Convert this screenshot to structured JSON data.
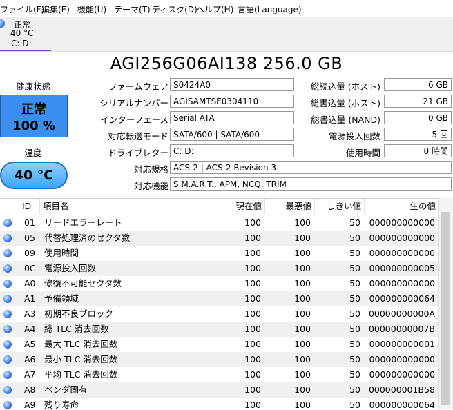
{
  "menu": [
    "ファイル(F)",
    "編集(E)",
    "機能(U)",
    "テーマ(T)",
    "ディスク(D)",
    "ヘルプ(H)",
    "言語(Language)"
  ],
  "drive_tab": {
    "status": "正常",
    "temp": "40 °C",
    "letters": "C: D:"
  },
  "model": "AGI256G06AI138 256.0 GB",
  "health": {
    "label": "健康状態",
    "status": "正常",
    "percent": "100 %"
  },
  "temperature": {
    "label": "温度",
    "value": "40 °C"
  },
  "info_left": [
    {
      "label": "ファームウェア",
      "value": "S0424A0"
    },
    {
      "label": "シリアルナンバー",
      "value": "AGISAMTSE0304110"
    },
    {
      "label": "インターフェース",
      "value": "Serial ATA"
    },
    {
      "label": "対応転送モード",
      "value": "SATA/600 | SATA/600"
    },
    {
      "label": "ドライブレター",
      "value": "C: D:"
    }
  ],
  "info_right": [
    {
      "label": "総読込量 (ホスト)",
      "value": "6 GB"
    },
    {
      "label": "総書込量 (ホスト)",
      "value": "21 GB"
    },
    {
      "label": "総書込量 (NAND)",
      "value": "0 GB"
    },
    {
      "label": "電源投入回数",
      "value": "5 回"
    },
    {
      "label": "使用時間",
      "value": "0 時間"
    }
  ],
  "standard": {
    "label": "対応規格",
    "value": "ACS-2 | ACS-2 Revision 3"
  },
  "features": {
    "label": "対応機能",
    "value": "S.M.A.R.T., APM, NCQ, TRIM"
  },
  "table": {
    "headers": [
      "ID",
      "項目名",
      "現在値",
      "最悪値",
      "しきい値",
      "生の値"
    ],
    "rows": [
      [
        "01",
        "リードエラーレート",
        "100",
        "100",
        "50",
        "000000000000"
      ],
      [
        "05",
        "代替処理済のセクタ数",
        "100",
        "100",
        "50",
        "000000000000"
      ],
      [
        "09",
        "使用時間",
        "100",
        "100",
        "50",
        "000000000000"
      ],
      [
        "0C",
        "電源投入回数",
        "100",
        "100",
        "50",
        "000000000005"
      ],
      [
        "A0",
        "修復不可能セクタ数",
        "100",
        "100",
        "50",
        "000000000000"
      ],
      [
        "A1",
        "予備領域",
        "100",
        "100",
        "50",
        "000000000064"
      ],
      [
        "A3",
        "初期不良ブロック",
        "100",
        "100",
        "50",
        "00000000000A"
      ],
      [
        "A4",
        "総 TLC 消去回数",
        "100",
        "100",
        "50",
        "00000000007B"
      ],
      [
        "A5",
        "最大 TLC 消去回数",
        "100",
        "100",
        "50",
        "000000000001"
      ],
      [
        "A6",
        "最小 TLC 消去回数",
        "100",
        "100",
        "50",
        "000000000000"
      ],
      [
        "A7",
        "平均 TLC 消去回数",
        "100",
        "100",
        "50",
        "000000000000"
      ],
      [
        "A8",
        "ベンダ固有",
        "100",
        "100",
        "50",
        "000000001B58"
      ],
      [
        "A9",
        "残り寿命",
        "100",
        "100",
        "50",
        "000000000064"
      ]
    ]
  }
}
